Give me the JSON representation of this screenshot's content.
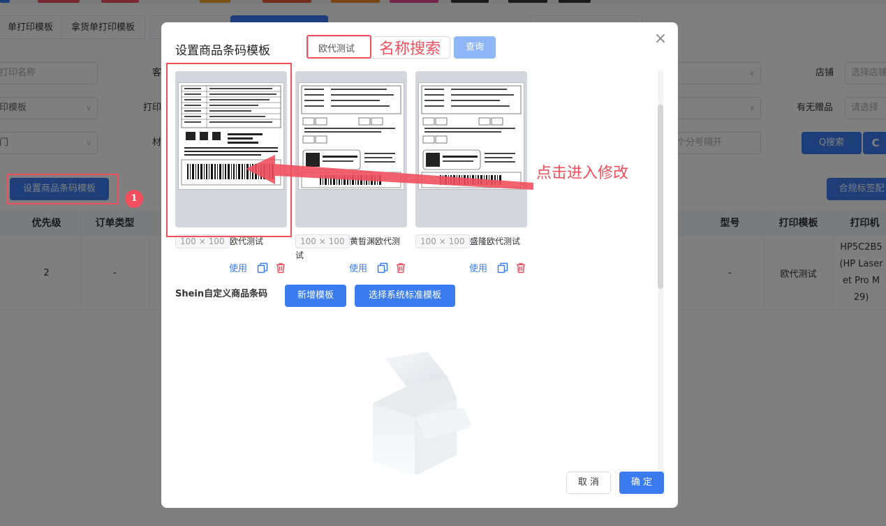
{
  "background": {
    "tabs": [
      "单打印模板",
      "拿货单打印模板",
      ""
    ],
    "form": {
      "print_name_placeholder": "打印名称",
      "label_ke": "客",
      "template_select": "印模板",
      "label_print": "打印",
      "label_cai": "材",
      "door_field": "门",
      "store_label": "店铺",
      "store_placeholder": "选择店铺",
      "gift_label": "有无赠品",
      "gift_placeholder": "请选择",
      "comma_placeholder": "个分号隔开",
      "search_button": "Q搜索",
      "refresh_icon": "C"
    },
    "set_template_button": "设置商品条码模板",
    "badge": "1",
    "merge_button": "合规标签配",
    "table": {
      "headers": [
        "优先级",
        "订单类型",
        "型号",
        "打印模板",
        "打印机"
      ],
      "row": {
        "priority": "2",
        "order_type": "-",
        "model": "-",
        "print_template": "欧代测试",
        "printer": "HP5C2B5 (HP Laser et Pro M 29)"
      }
    }
  },
  "modal": {
    "title": "设置商品条码模板",
    "search_value": "欧代测试",
    "search_annotation": "名称搜索",
    "query_button": "查询",
    "close_icon": "×",
    "templates": [
      {
        "size": "100 × 100",
        "name": "欧代测试",
        "use": "使用"
      },
      {
        "size": "100 × 100",
        "name": "黄晢渊欧代测试",
        "use": "使用"
      },
      {
        "size": "100 × 100",
        "name": "盛隆欧代测试",
        "use": "使用"
      }
    ],
    "section_label": "Shein自定义商品条码",
    "add_template_button": "新增模板",
    "system_template_button": "选择系统标准模板",
    "cancel_button": "取 消",
    "confirm_button": "确 定"
  },
  "annotation": {
    "click_to_edit": "点击进入修改"
  },
  "colors": {
    "primary": "#3a7cf0",
    "annotation_red": "#f0505e",
    "overlay": "rgba(0,0,0,0.5)"
  }
}
